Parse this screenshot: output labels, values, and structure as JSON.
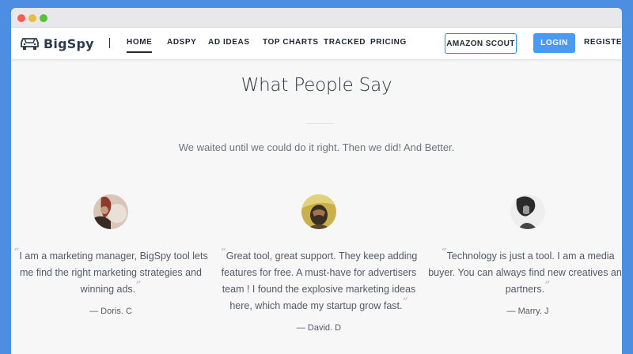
{
  "brand": {
    "name": "BigSpy"
  },
  "nav": {
    "items": [
      {
        "label": "HOME",
        "active": true
      },
      {
        "label": "ADSPY",
        "active": false
      },
      {
        "label": "AD IDEAS",
        "active": false
      },
      {
        "label": "TOP CHARTS",
        "active": false
      },
      {
        "label": "TRACKED",
        "active": false
      },
      {
        "label": "PRICING",
        "active": false
      }
    ],
    "amazon_scout": "AMAZON SCOUT",
    "login": "LOGIN",
    "register": "REGISTER"
  },
  "section": {
    "title": "What People Say",
    "subtitle": "We waited until we could do it right. Then we did! And Better."
  },
  "testimonials": [
    {
      "quote": "I am a marketing manager, BigSpy tool lets me find the right marketing strategies and winning ads.",
      "author": "— Doris. C"
    },
    {
      "quote": "Great tool, great support. They keep adding features for free. A must-have for advertisers team ! I found the explosive marketing ideas here, which made my startup grow fast.",
      "author": "— David. D"
    },
    {
      "quote": "Technology is just a tool. I am a media buyer. You can always find new creatives and partners.",
      "author": "— Marry. J"
    }
  ],
  "colors": {
    "page_background": "#4d8ee2",
    "accent": "#4c99f2",
    "outline_button_border": "#2d8fc8",
    "text_dark": "#1f2733"
  }
}
